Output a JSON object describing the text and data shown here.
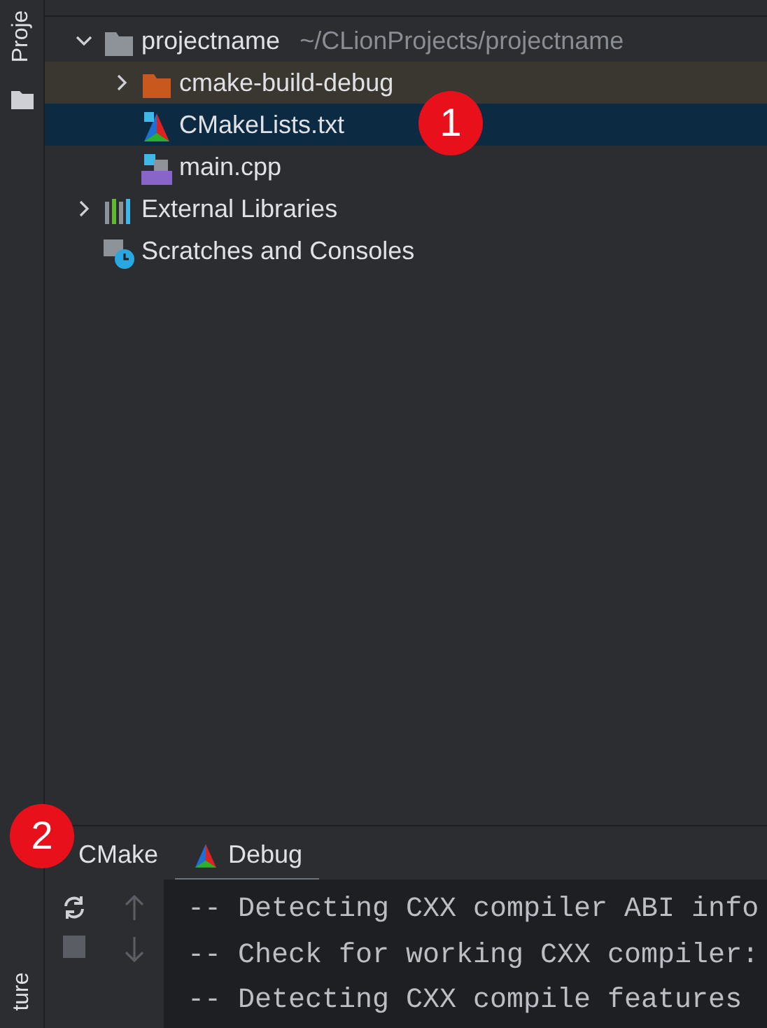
{
  "side_stripe": {
    "top_tab": "Proje",
    "bottom_tab": "ture"
  },
  "tree": [
    {
      "label": "projectname",
      "hint": "~/CLionProjects/projectname",
      "kind": "folder",
      "expanded": true,
      "selected": false,
      "children": [
        {
          "label": "cmake-build-debug",
          "kind": "excluded-folder",
          "expanded": false,
          "selected": false,
          "highlighted": true
        },
        {
          "label": "CMakeLists.txt",
          "kind": "cmake",
          "selected": true
        },
        {
          "label": "main.cpp",
          "kind": "source",
          "selected": false
        }
      ]
    },
    {
      "label": "External Libraries",
      "kind": "libraries",
      "expanded": false,
      "selected": false
    },
    {
      "label": "Scratches and Consoles",
      "kind": "scratches",
      "selected": false
    }
  ],
  "markers": [
    "1",
    "2"
  ],
  "bottom_tabs": [
    {
      "label": "CMake",
      "selected": false,
      "kind": "plain"
    },
    {
      "label": "Debug",
      "selected": true,
      "kind": "cmake"
    }
  ],
  "console_lines": [
    "-- Detecting CXX compiler ABI info",
    "-- Check for working CXX compiler:",
    "-- Detecting CXX compile features"
  ]
}
